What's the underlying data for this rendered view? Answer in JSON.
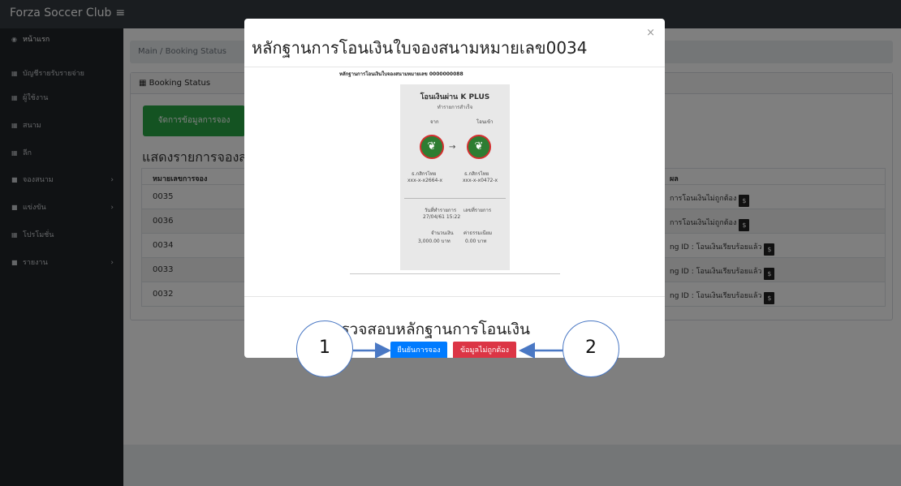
{
  "app": {
    "brand": "Forza Soccer Club",
    "menu_toggle": "≡"
  },
  "sidebar": {
    "items": [
      {
        "label": "หน้าแรก",
        "icon": "dashboard-icon"
      },
      {
        "label": "บัญชีรายรับรายจ่าย",
        "icon": "table-icon"
      },
      {
        "label": "ผู้ใช้งาน",
        "icon": "table-icon"
      },
      {
        "label": "สนาม",
        "icon": "table-icon"
      },
      {
        "label": "ลีก",
        "icon": "table-icon"
      },
      {
        "label": "จองสนาม",
        "icon": "folder-icon",
        "caret": "›"
      },
      {
        "label": "แข่งขัน",
        "icon": "folder-icon",
        "caret": "›"
      },
      {
        "label": "โปรโมชั่น",
        "icon": "table-icon"
      },
      {
        "label": "รายงาน",
        "icon": "folder-icon",
        "caret": "›"
      }
    ]
  },
  "breadcrumb": "Main / Booking Status",
  "card": {
    "header": "Booking Status",
    "manage_button": "จัดการข้อมูลการจอง",
    "list_title": "แสดงรายการจองสน",
    "columns": [
      "หมายเลขการจอง",
      "ผล"
    ],
    "rows": [
      {
        "id": "0035",
        "status": "การโอนเงินไม่ถูกต้อง"
      },
      {
        "id": "0036",
        "status": "การโอนเงินไม่ถูกต้อง"
      },
      {
        "id": "0034",
        "status": "ng ID : โอนเงินเรียบร้อยแล้ว"
      },
      {
        "id": "0033",
        "status": "ng ID : โอนเงินเรียบร้อยแล้ว"
      },
      {
        "id": "0032",
        "status": "ng ID : โอนเงินเรียบร้อยแล้ว"
      }
    ]
  },
  "modal": {
    "title": "หลักฐานการโอนเงินใบจองสนามหมายเลข0034",
    "close": "×",
    "slip_caption": "หลักฐานการโอนเงินใบจองสนามหมายเลข 0000000088",
    "slip": {
      "title": "โอนเงินผ่าน K PLUS",
      "subtitle": "ทำรายการสำเร็จ",
      "from_label": "จาก",
      "to_label": "โอนเข้า",
      "from_bank": "ธ.กสิกรไทย",
      "from_account": "xxx-x-x2664-x",
      "to_bank": "ธ.กสิกรไทย",
      "to_account": "xxx-x-x0472-x",
      "date_label": "วันที่ทำรายการ",
      "date_value": "27/04/61 15:22",
      "ref_label": "เลขที่รายการ",
      "amount_label": "จำนวนเงิน",
      "amount_value": "3,000.00 บาท",
      "fee_label": "ค่าธรรมเนียม",
      "fee_value": "0.00 บาท"
    },
    "verify_title": "ตรวจสอบหลักฐานการโอนเงิน",
    "confirm_button": "ยืนยันการจอง",
    "reject_button": "ข้อมูลไม่ถูกต้อง"
  },
  "annotations": {
    "callout_1": "1",
    "callout_2": "2"
  },
  "colors": {
    "navbar": "#343a40",
    "sidebar": "#212529",
    "success": "#28a745",
    "primary": "#007bff",
    "danger": "#dc3545",
    "annotation": "#4a78c4"
  }
}
